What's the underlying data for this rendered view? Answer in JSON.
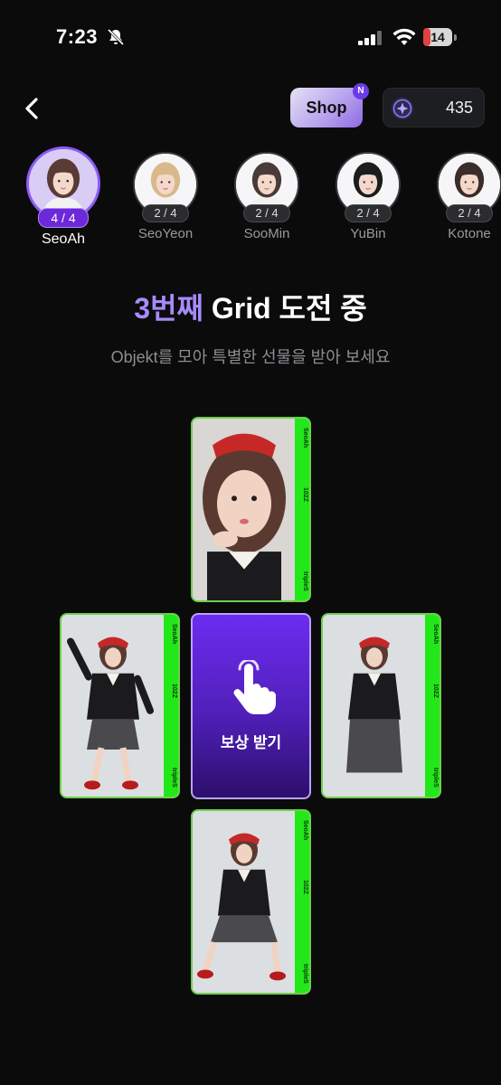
{
  "status_bar": {
    "time": "7:23",
    "battery": "14",
    "battery_level_percent": 14
  },
  "header": {
    "shop_label": "Shop",
    "shop_badge": "N",
    "points": "435"
  },
  "members": [
    {
      "name": "SeoAh",
      "count": "4 / 4",
      "active": true
    },
    {
      "name": "SeoYeon",
      "count": "2 / 4",
      "active": false
    },
    {
      "name": "SooMin",
      "count": "2 / 4",
      "active": false
    },
    {
      "name": "YuBin",
      "count": "2 / 4",
      "active": false
    },
    {
      "name": "Kotone",
      "count": "2 / 4",
      "active": false
    }
  ],
  "challenge": {
    "title_accent": "3번째",
    "title_rest": "Grid 도전 중",
    "subtitle": "Objekt를 모아 특별한 선물을 받아 보세요"
  },
  "grid": {
    "reward_label": "보상 받기",
    "cards": [
      {
        "position": "top",
        "member": "SeoAh",
        "serial": "102Z",
        "brand": "tripleS"
      },
      {
        "position": "left",
        "member": "SeoAh",
        "serial": "102Z",
        "brand": "tripleS"
      },
      {
        "position": "right",
        "member": "SeoAh",
        "serial": "102Z",
        "brand": "tripleS"
      },
      {
        "position": "bottom",
        "member": "SeoAh",
        "serial": "102Z",
        "brand": "tripleS"
      }
    ]
  },
  "colors": {
    "accent": "#a78bfa",
    "card_strip": "#22e81a",
    "background": "#0b0b0c"
  }
}
